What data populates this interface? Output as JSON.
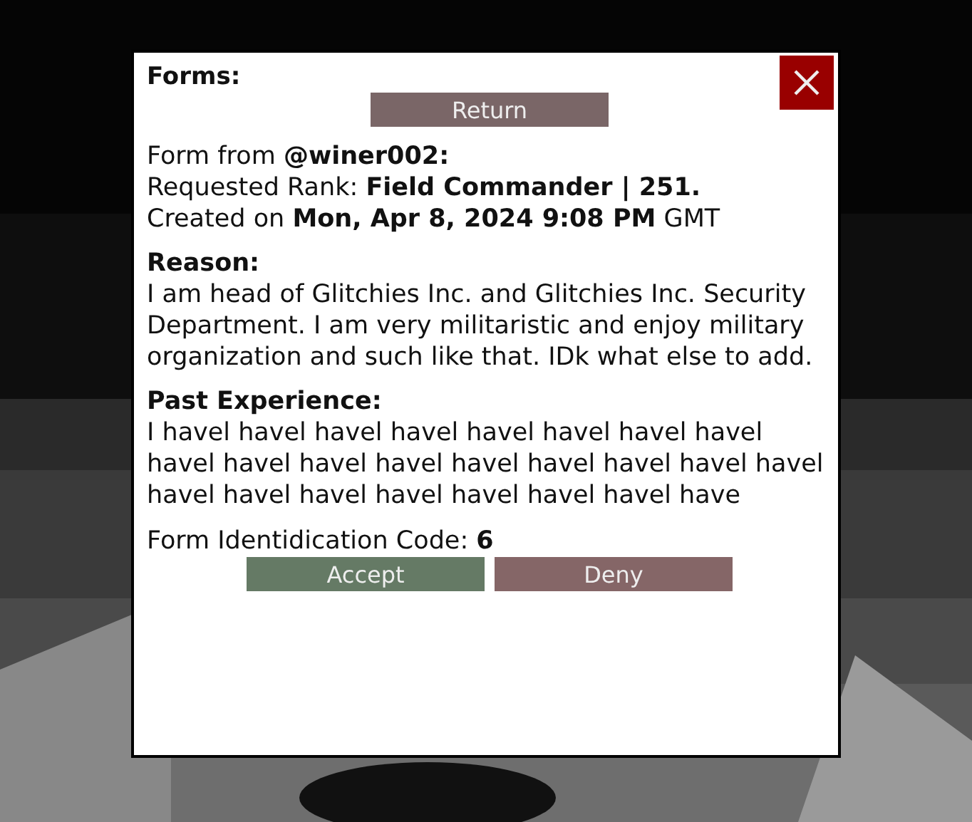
{
  "title": "Forms:",
  "return_button": "Return",
  "details": [
    "Form from **@winer002:**",
    "Requested Rank: **Field Commander | 251.**",
    "Created on **Mon, Apr 8, 2024 9:08 PM** GMT"
  ],
  "sections": [
    {
      "heading": "Reason:",
      "body": "I am head of Glitchies Inc. and Glitchies Inc. Security Department. I am very militaristic and enjoy military organization and such like that. IDk what else to add."
    },
    {
      "heading": "Past Experience:",
      "body": "I havel havel havel havel havel havel havel havel havel havel havel havel havel havel havel havel havel havel havel havel havel havel havel havel have"
    }
  ],
  "code_line": "Form Identidication Code: **6**",
  "actions": [
    {
      "label": "Accept",
      "kind": "accept"
    },
    {
      "label": "Deny",
      "kind": "deny"
    }
  ]
}
